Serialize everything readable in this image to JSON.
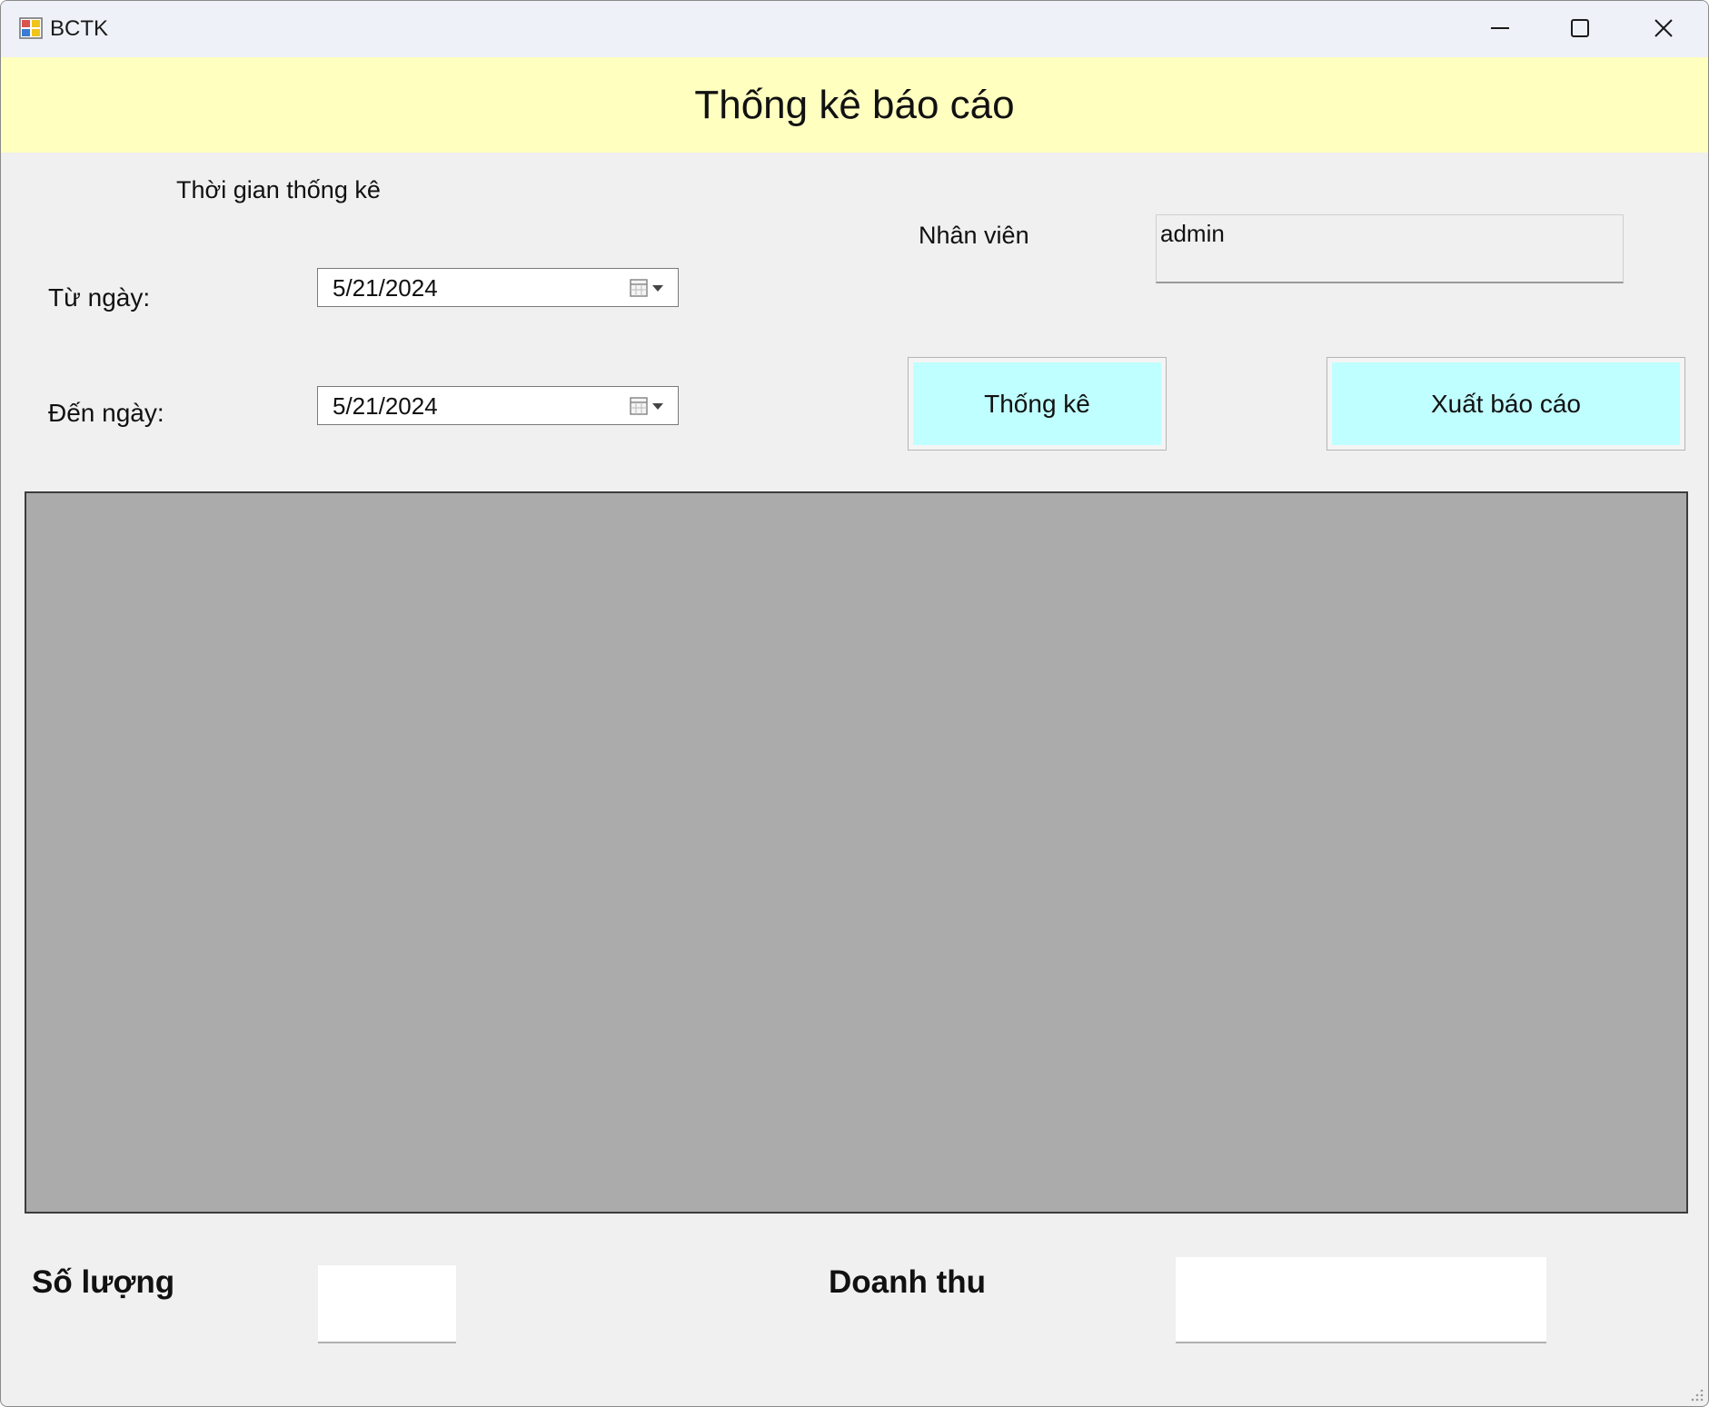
{
  "window": {
    "title": "BCTK"
  },
  "header": {
    "title": "Thống kê báo cáo"
  },
  "filters": {
    "section_label": "Thời gian thống kê",
    "from_label": "Từ ngày:",
    "from_value": "5/21/2024",
    "to_label": "Đến ngày:",
    "to_value": "5/21/2024"
  },
  "employee": {
    "label": "Nhân viên",
    "value": "admin"
  },
  "actions": {
    "statistics_label": "Thống kê",
    "export_label": "Xuất báo cáo"
  },
  "summary": {
    "quantity_label": "Số lượng",
    "quantity_value": "",
    "revenue_label": "Doanh thu",
    "revenue_value": ""
  },
  "colors": {
    "header_band": "#ffffc0",
    "button_fill": "#c0ffff",
    "grid_fill": "#ababab",
    "form_bg": "#f0f0f0"
  },
  "icons": [
    "app-icon",
    "minimize-icon",
    "maximize-icon",
    "close-icon",
    "calendar-dropdown-icon",
    "resize-grip-icon"
  ]
}
